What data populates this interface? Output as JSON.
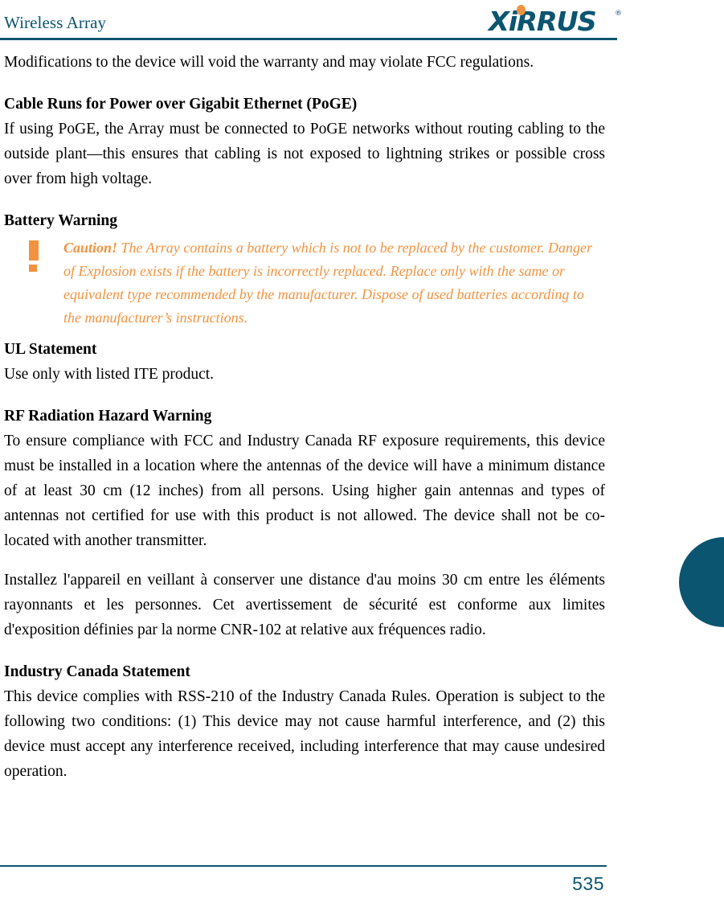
{
  "header": {
    "title": "Wireless Array",
    "logo_text": "XiRRUS",
    "logo_registered": "®",
    "logo_color": "#0b5570",
    "logo_dot_color": "#f3933f"
  },
  "content": {
    "intro_paragraph": "Modifications to the device will void the warranty and may violate FCC regulations.",
    "sections": [
      {
        "heading": "Cable Runs for Power over Gigabit Ethernet (PoGE)",
        "paragraph": "If using PoGE, the Array must be connected to PoGE networks without routing cabling to the outside plant—this ensures that cabling is not exposed to lightning strikes or possible cross over from high voltage."
      },
      {
        "heading": "Battery Warning"
      },
      {
        "heading": "UL Statement",
        "paragraph": "Use only with listed ITE product."
      },
      {
        "heading": "RF Radiation Hazard Warning",
        "paragraph": "To ensure compliance with FCC and Industry Canada RF exposure requirements, this device must be installed in a location where the antennas of the device will have a minimum distance of at least 30 cm (12 inches) from all persons. Using higher gain antennas and types of antennas not certified for use with this product is not allowed. The device shall not be co-located with another transmitter.",
        "paragraph_fr": "Installez l'appareil en veillant à conserver une distance d'au moins 30 cm entre les éléments rayonnants et les personnes. Cet avertissement de sécurité est conforme aux limites d'exposition définies par la norme CNR-102 at relative aux fréquences radio."
      },
      {
        "heading": "Industry Canada Statement",
        "paragraph": "This device complies with RSS-210 of the Industry Canada Rules. Operation is subject to the following two conditions: (1) This device may not cause harmful interference, and (2) this device must accept any interference received, including interference that may cause undesired operation."
      }
    ],
    "caution": {
      "icon_name": "exclamation-warning-icon",
      "lead": "Caution!",
      "text": " The Array contains a battery which is not to be replaced by the customer. Danger of Explosion exists if the battery is incorrectly replaced. Replace only with the same or equivalent type recommended by the manufacturer. Dispose of used batteries according to the manufacturer’s instructions.",
      "color": "#f3933f"
    }
  },
  "edge_tab": {
    "color": "#0b5570"
  },
  "footer": {
    "page_number": "535",
    "rule_color": "#0b5570"
  }
}
